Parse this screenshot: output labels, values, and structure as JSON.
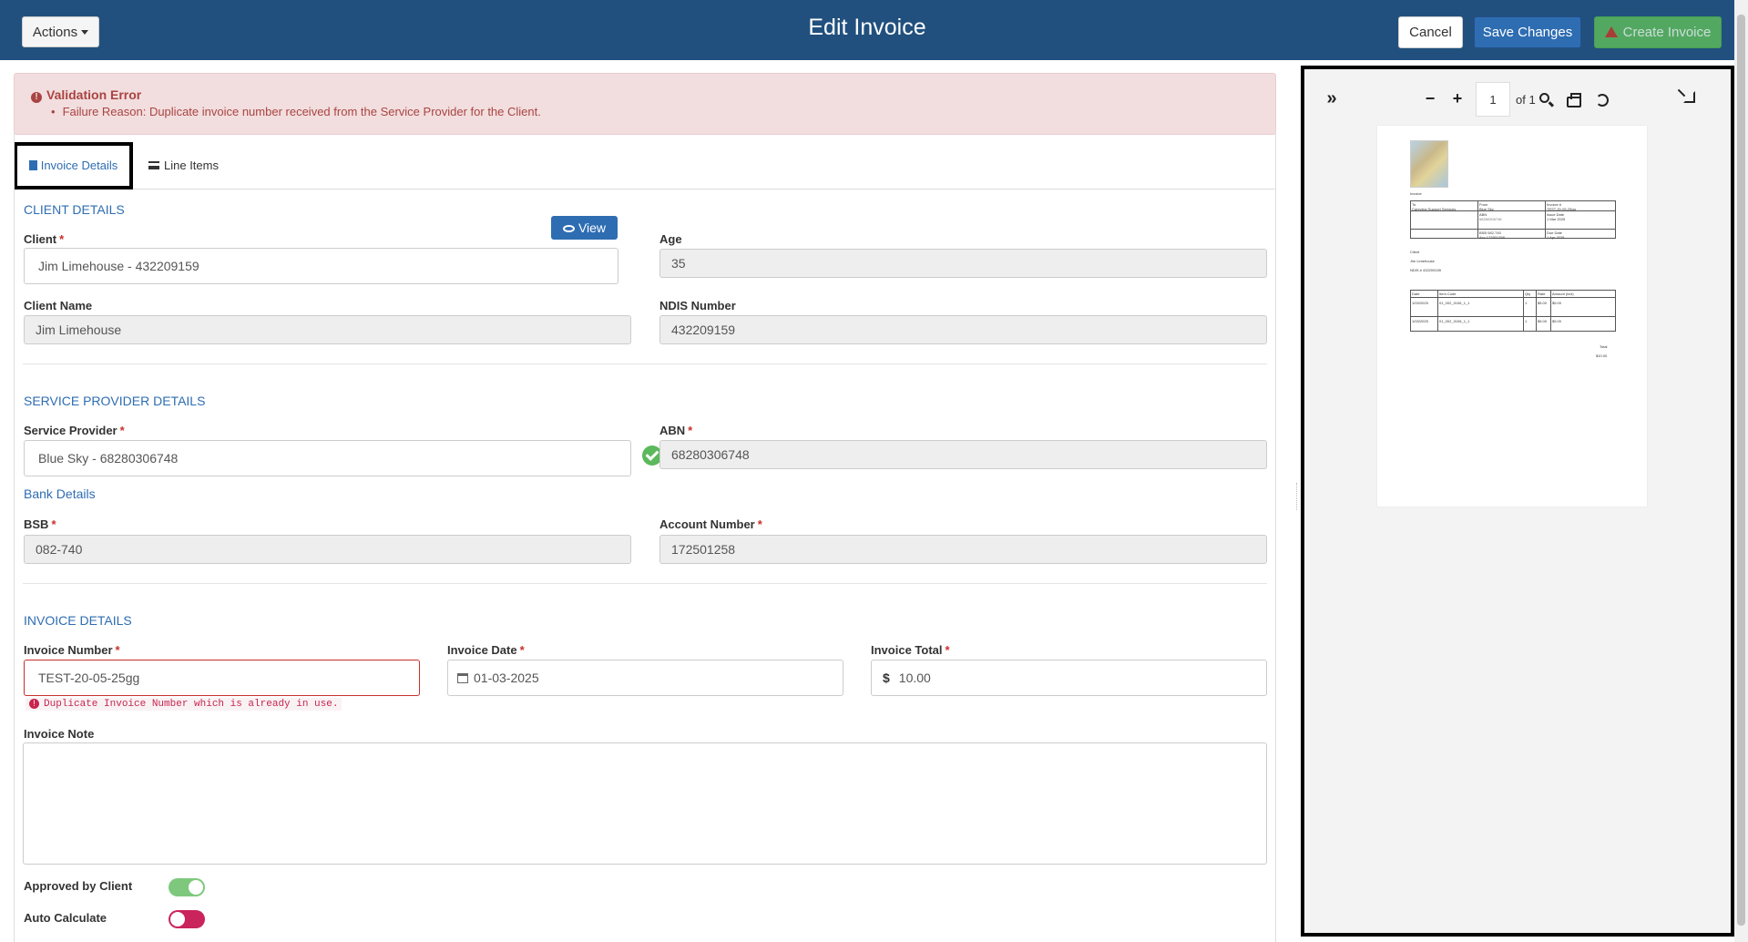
{
  "header": {
    "actions_label": "Actions",
    "title": "Edit Invoice",
    "cancel_label": "Cancel",
    "save_label": "Save Changes",
    "create_label": "Create Invoice"
  },
  "alert": {
    "title": "Validation Error",
    "item": "Failure Reason: Duplicate invoice number received from the Service Provider for the Client."
  },
  "tabs": [
    {
      "label": "Invoice Details",
      "active": true
    },
    {
      "label": "Line Items",
      "active": false
    }
  ],
  "client_section": {
    "title": "CLIENT DETAILS",
    "view_label": "View",
    "client_label": "Client",
    "client_value": "Jim Limehouse - 432209159",
    "age_label": "Age",
    "age_value": "35",
    "client_name_label": "Client Name",
    "client_name_value": "Jim Limehouse",
    "ndis_label": "NDIS Number",
    "ndis_value": "432209159"
  },
  "provider_section": {
    "title": "SERVICE PROVIDER DETAILS",
    "provider_label": "Service Provider",
    "provider_value": "Blue Sky - 68280306748",
    "abn_label": "ABN",
    "abn_value": "68280306748",
    "bank_link": "Bank Details",
    "bsb_label": "BSB",
    "bsb_value": "082-740",
    "account_label": "Account Number",
    "account_value": "172501258"
  },
  "invoice_section": {
    "title": "INVOICE DETAILS",
    "number_label": "Invoice Number",
    "number_value": "TEST-20-05-25gg",
    "number_error": "Duplicate Invoice Number which is already in use.",
    "date_label": "Invoice Date",
    "date_value": "01-03-2025",
    "total_label": "Invoice Total",
    "total_currency": "$",
    "total_value": "10.00",
    "note_label": "Invoice Note",
    "note_value": "",
    "approved_label": "Approved by Client",
    "approved_on": true,
    "auto_label": "Auto Calculate",
    "auto_on": false
  },
  "preview": {
    "page_number": "1",
    "page_of": "of 1",
    "doc": {
      "heading": "Invoice",
      "to_label": "To",
      "to_value": "Careview Support Services",
      "from_label": "From",
      "from_value": "Blue Sky",
      "abn_label": "ABN",
      "abn_value": "68280306748",
      "bsb_value": "BSB 082-740",
      "acc_value": "Acc 172501258",
      "inv_label": "Invoice #",
      "inv_value": "TEST-20-05-25gg",
      "issue_label": "Issue Date",
      "issue_value": "1 Mar 2025",
      "due_label": "Due Date",
      "due_value": "1 Apr 2025",
      "client_label": "Client",
      "client_name": "Jim Limehouse",
      "client_ndis": "NDIS # 432209159",
      "cols": [
        "Date",
        "Item Code",
        "Qty",
        "Rate",
        "Amount (incl)"
      ],
      "rows": [
        [
          "1/03/2025",
          "01_002_0106_1_1",
          "1",
          "$5.00",
          "$5.00"
        ],
        [
          "1/03/2025",
          "01_002_0106_1_1",
          "1",
          "$5.00",
          "$5.00"
        ]
      ],
      "total_label": "Total",
      "total_value": "$10.00"
    }
  },
  "colors": {
    "header_bg": "#21507e",
    "primary": "#2e6db2",
    "error": "#c9302c",
    "success": "#5cb85c"
  }
}
